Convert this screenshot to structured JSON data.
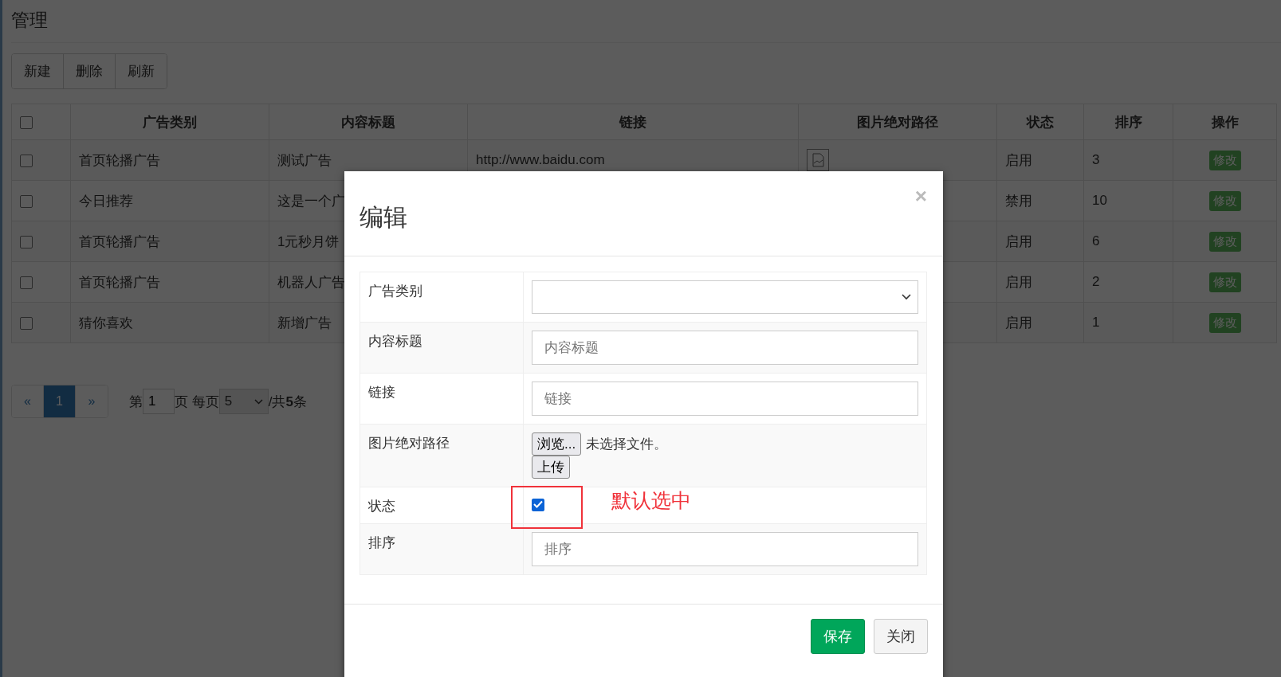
{
  "page_title": "管理",
  "toolbar": [
    "新建",
    "删除",
    "刷新"
  ],
  "table": {
    "header_checked": false,
    "columns": [
      "广告类别",
      "内容标题",
      "链接",
      "图片绝对路径",
      "状态",
      "排序",
      "操作"
    ],
    "rows": [
      {
        "checked": false,
        "category": "首页轮播广告",
        "title": "测试广告",
        "link": "http://www.baidu.com",
        "has_image": true,
        "status": "启用",
        "order": "3",
        "action": "修改"
      },
      {
        "checked": false,
        "category": "今日推荐",
        "title": "这是一个广",
        "status": "禁用",
        "order": "10",
        "action": "修改"
      },
      {
        "checked": false,
        "category": "首页轮播广告",
        "title": "1元秒月饼",
        "status": "启用",
        "order": "6",
        "action": "修改"
      },
      {
        "checked": false,
        "category": "首页轮播广告",
        "title": "机器人广告",
        "status": "启用",
        "order": "2",
        "action": "修改"
      },
      {
        "checked": false,
        "category": "猜你喜欢",
        "title": "新增广告",
        "status": "启用",
        "order": "1",
        "action": "修改"
      }
    ]
  },
  "pagination": {
    "prev": "«",
    "pages": [
      {
        "label": "1",
        "selected": true
      }
    ],
    "next": "»",
    "page_prefix": "第",
    "page_value": "1",
    "page_suffix": "页 每页",
    "page_size": "5",
    "total": "/共**5**条"
  },
  "modal": {
    "title": "编辑",
    "close": "×",
    "fields": [
      {
        "kind": "select",
        "label": "广告类别"
      },
      {
        "kind": "text",
        "label": "内容标题",
        "placeholder": "内容标题"
      },
      {
        "kind": "text",
        "label": "链接",
        "placeholder": "链接"
      },
      {
        "kind": "file",
        "label": "图片绝对路径",
        "browse": "浏览...",
        "file_text": "未选择文件。",
        "upload": "上传"
      },
      {
        "kind": "checkbox",
        "label": "状态",
        "checked": true,
        "annotation": "默认选中"
      },
      {
        "kind": "text",
        "label": "排序",
        "placeholder": "排序"
      }
    ],
    "buttons": [
      {
        "label": "保存",
        "kind": "primary"
      },
      {
        "label": "关闭",
        "kind": "default"
      }
    ]
  }
}
